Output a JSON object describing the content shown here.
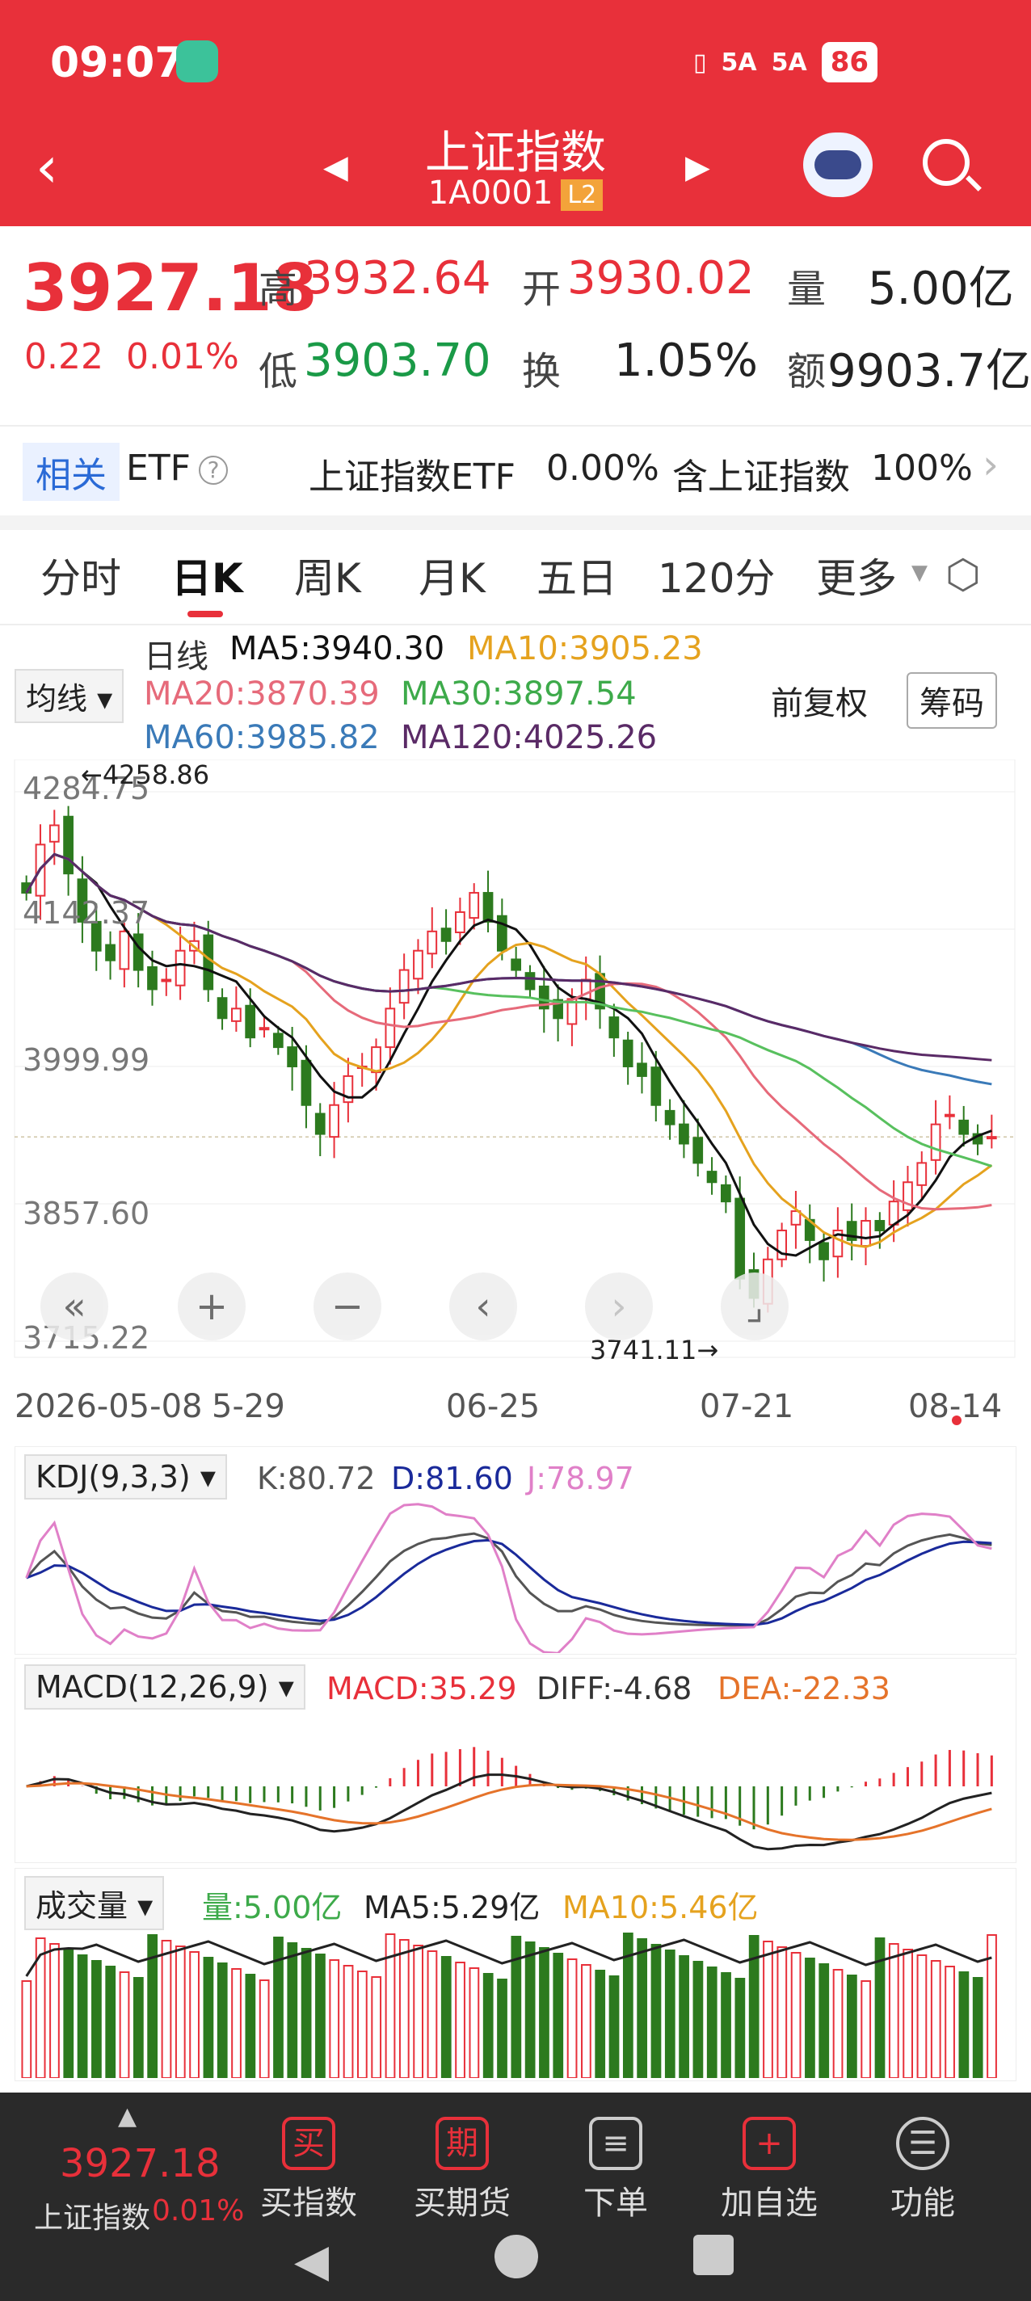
{
  "status_bar": {
    "time": "09:07",
    "signal_1": "5A",
    "signal_2": "5A",
    "battery": "86"
  },
  "header": {
    "title": "上证指数",
    "code": "1A0001",
    "level_badge": "L2"
  },
  "quote": {
    "price": "3927.18",
    "change": "0.22",
    "change_pct": "0.01%",
    "high_label": "高",
    "high": "3932.64",
    "open_label": "开",
    "open": "3930.02",
    "volume_label": "量",
    "volume": "5.00亿",
    "low_label": "低",
    "low": "3903.70",
    "turnover_label": "换",
    "turnover": "1.05%",
    "amount_label": "额",
    "amount": "9903.7亿"
  },
  "etf_row": {
    "tag": "相关",
    "etf_label": "ETF",
    "info_icon": "info-icon",
    "name": "上证指数ETF",
    "value": "0.00%",
    "contains_label": "含上证指数",
    "contains_pct": "100%"
  },
  "tabs": [
    {
      "label": "分时"
    },
    {
      "label": "日K",
      "active": true
    },
    {
      "label": "周K"
    },
    {
      "label": "月K"
    },
    {
      "label": "五日"
    },
    {
      "label": "120分"
    },
    {
      "label": "更多"
    }
  ],
  "ma_legend": {
    "indicator_select": "均线",
    "period": "日线",
    "ma5": "MA5:3940.30",
    "ma10": "MA10:3905.23",
    "ma20": "MA20:3870.39",
    "ma30": "MA30:3897.54",
    "ma60": "MA60:3985.82",
    "ma120": "MA120:4025.26",
    "adjust": "前复权",
    "chips": "筹码"
  },
  "colors": {
    "up": "#e8303a",
    "down": "#2c7a1e",
    "ma5": "#111111",
    "ma10": "#e5a21e",
    "ma20": "#e66a7a",
    "ma30": "#58c05e",
    "ma60": "#3a7ab8",
    "ma120": "#5a2a66",
    "header_bg": "#e8303a"
  },
  "chart_data": {
    "type": "candlestick",
    "y_ticks": [
      "4284.75",
      "4142.37",
      "3999.99",
      "3857.60",
      "3715.22"
    ],
    "ylim": [
      3715.22,
      4284.75
    ],
    "x_ticks": [
      "2026-05-08",
      "5-29",
      "06-25",
      "07-21",
      "08-14"
    ],
    "high_marker": "←4258.86",
    "low_marker": "3741.11→",
    "closes": [
      4180,
      4230,
      4250,
      4200,
      4150,
      4120,
      4110,
      4140,
      4100,
      4080,
      4090,
      4120,
      4130,
      4080,
      4050,
      4060,
      4030,
      4040,
      4020,
      4000,
      3960,
      3930,
      3960,
      3990,
      4000,
      4020,
      4060,
      4100,
      4120,
      4140,
      4130,
      4160,
      4180,
      4150,
      4120,
      4100,
      4080,
      4060,
      4050,
      4070,
      4090,
      4060,
      4030,
      4000,
      3990,
      3960,
      3940,
      3920,
      3900,
      3880,
      3860,
      3780,
      3760,
      3800,
      3830,
      3850,
      3820,
      3800,
      3830,
      3820,
      3840,
      3830,
      3860,
      3880,
      3900,
      3940,
      3950,
      3930,
      3920,
      3927
    ]
  },
  "controls": {
    "fast_back": "«",
    "zoom_in": "+",
    "zoom_out": "−",
    "prev": "‹",
    "next": "›"
  },
  "kdj": {
    "name": "KDJ(9,3,3)",
    "k": "K:80.72",
    "d": "D:81.60",
    "j": "J:78.97"
  },
  "macd": {
    "name": "MACD(12,26,9)",
    "macd": "MACD:35.29",
    "diff": "DIFF:-4.68",
    "dea": "DEA:-22.33"
  },
  "volume": {
    "name": "成交量",
    "vol": "量:5.00亿",
    "ma5": "MA5:5.29亿",
    "ma10": "MA10:5.46亿"
  },
  "bottom_bar": {
    "price": "3927.18",
    "name": "上证指数",
    "pct": "0.01%",
    "items": [
      {
        "icon": "买",
        "label": "买指数"
      },
      {
        "icon": "期",
        "label": "买期货"
      },
      {
        "icon": "≡",
        "label": "下单"
      },
      {
        "icon": "+",
        "label": "加自选"
      },
      {
        "icon": "☰",
        "label": "功能"
      }
    ]
  }
}
